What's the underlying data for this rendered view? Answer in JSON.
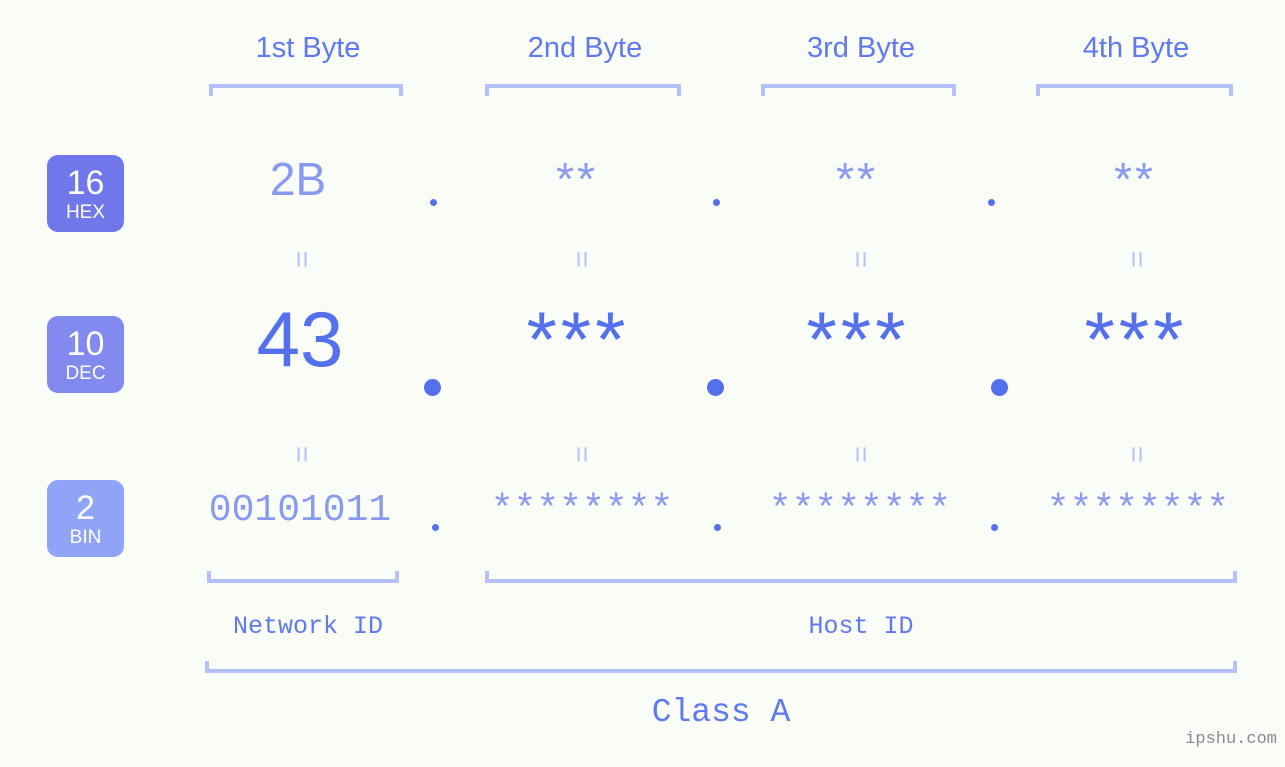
{
  "meta": {
    "background_color": "#fafcf8",
    "accent_strong": "#5570ec",
    "accent_mid": "#6079ee",
    "accent_light": "#8a99f0",
    "accent_pale": "#b6c0f8",
    "watermark_color": "#8b8b8b"
  },
  "byte_headers": [
    {
      "label": "1st Byte"
    },
    {
      "label": "2nd Byte"
    },
    {
      "label": "3rd Byte"
    },
    {
      "label": "4th Byte"
    }
  ],
  "bases": [
    {
      "number": "16",
      "abbr": "HEX",
      "color": "#6f77ea"
    },
    {
      "number": "10",
      "abbr": "DEC",
      "color": "#828aef"
    },
    {
      "number": "2",
      "abbr": "BIN",
      "color": "#8fa4f6"
    }
  ],
  "rows": {
    "hex": {
      "base_number": "16",
      "base_abbr": "HEX",
      "values": [
        "2B",
        "**",
        "**",
        "**"
      ],
      "separator": "."
    },
    "dec": {
      "base_number": "10",
      "base_abbr": "DEC",
      "values": [
        "43",
        "***",
        "***",
        "***"
      ],
      "separator": "."
    },
    "bin": {
      "base_number": "2",
      "base_abbr": "BIN",
      "values": [
        "00101011",
        "********",
        "********",
        "********"
      ],
      "separator": "."
    }
  },
  "equals": {
    "symbol": "=",
    "hex_to_dec": [
      "=",
      "=",
      "=",
      "="
    ],
    "dec_to_bin": [
      "=",
      "=",
      "=",
      "="
    ]
  },
  "sections": {
    "network_id": "Network ID",
    "host_id": "Host ID",
    "class": "Class A"
  },
  "watermark": "ipshu.com"
}
